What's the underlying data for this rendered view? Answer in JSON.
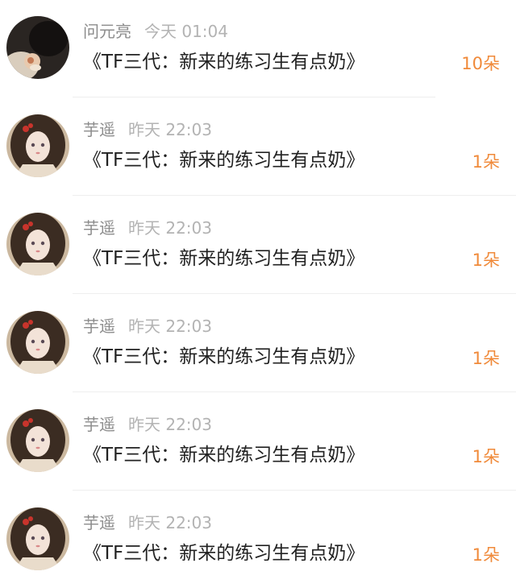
{
  "colors": {
    "amount": "#f08a3a",
    "username": "#8c8c8c",
    "time": "#b3b3b3",
    "title": "#222222",
    "divider": "#eeeeee"
  },
  "items": [
    {
      "username": "问元亮",
      "time": "今天 01:04",
      "title": "《TF三代：新来的练习生有点奶》",
      "amount": "10朵",
      "avatar": "dark-avatar-icon"
    },
    {
      "username": "芋遥",
      "time": "昨天 22:03",
      "title": "《TF三代：新来的练习生有点奶》",
      "amount": "1朵",
      "avatar": "girl-avatar-icon"
    },
    {
      "username": "芋遥",
      "time": "昨天 22:03",
      "title": "《TF三代：新来的练习生有点奶》",
      "amount": "1朵",
      "avatar": "girl-avatar-icon"
    },
    {
      "username": "芋遥",
      "time": "昨天 22:03",
      "title": "《TF三代：新来的练习生有点奶》",
      "amount": "1朵",
      "avatar": "girl-avatar-icon"
    },
    {
      "username": "芋遥",
      "time": "昨天 22:03",
      "title": "《TF三代：新来的练习生有点奶》",
      "amount": "1朵",
      "avatar": "girl-avatar-icon"
    },
    {
      "username": "芋遥",
      "time": "昨天 22:03",
      "title": "《TF三代：新来的练习生有点奶》",
      "amount": "1朵",
      "avatar": "girl-avatar-icon"
    }
  ]
}
